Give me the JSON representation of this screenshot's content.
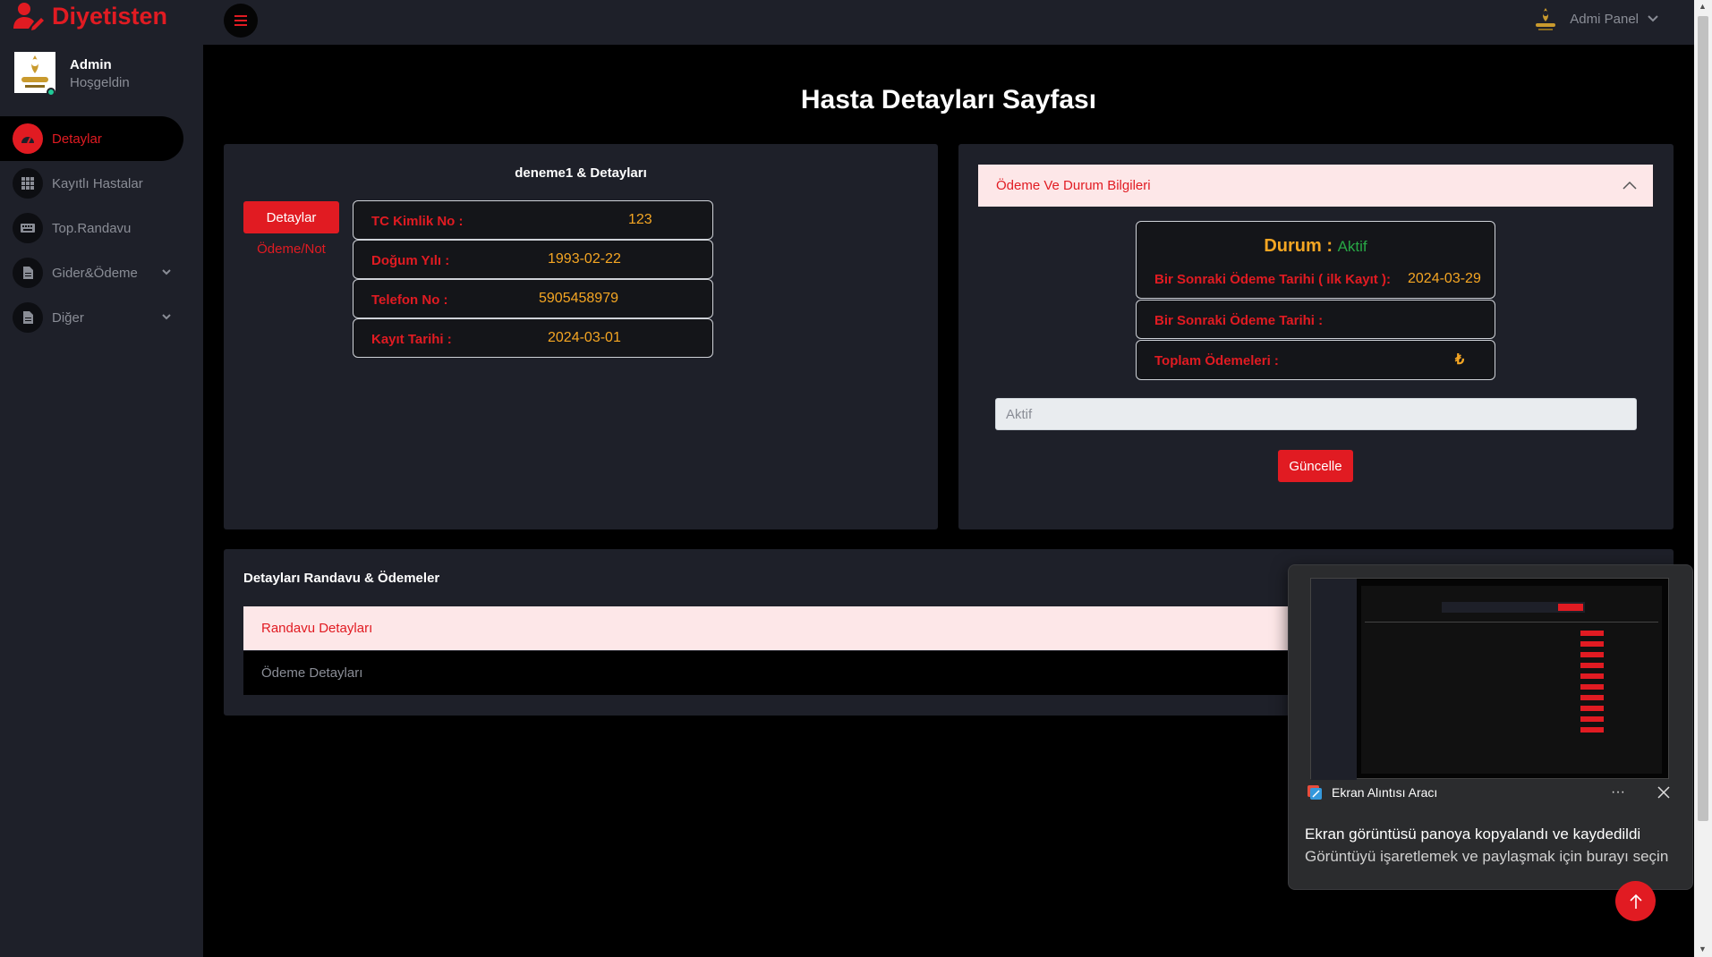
{
  "brand": {
    "name": "Diyetisten"
  },
  "header": {
    "admin_label": "Admi Panel"
  },
  "profile": {
    "name": "Admin",
    "subtitle": "Hoşgeldin"
  },
  "sidebar": {
    "items": [
      {
        "label": "Detaylar",
        "icon": "dashboard-icon"
      },
      {
        "label": "Kayıtlı Hastalar",
        "icon": "grid-icon"
      },
      {
        "label": "Top.Randavu",
        "icon": "keyboard-icon"
      },
      {
        "label": "Gider&Ödeme",
        "icon": "document-icon"
      },
      {
        "label": "Diğer",
        "icon": "document-icon"
      }
    ]
  },
  "page": {
    "title": "Hasta Detayları Sayfası"
  },
  "patient": {
    "title": "deneme1 & Detayları",
    "tabs": {
      "details": "Detaylar",
      "payment": "Ödeme/Not"
    },
    "fields": [
      {
        "label": "TC Kimlik No :",
        "value": "123"
      },
      {
        "label": "Doğum Yılı :",
        "value": "1993-02-22"
      },
      {
        "label": "Telefon No :",
        "value": "5905458979"
      },
      {
        "label": "Kayıt Tarihi :",
        "value": "2024-03-01"
      }
    ]
  },
  "status": {
    "accordion_title": "Ödeme Ve Durum Bilgileri",
    "durum_label": "Durum :",
    "durum_value": "Aktif",
    "next_payment_first_label": "Bir Sonraki Ödeme Tarihi ( ilk Kayıt ):",
    "next_payment_first_value": "2024-03-29",
    "next_payment_label": "Bir Sonraki Ödeme Tarihi :",
    "next_payment_value": "",
    "total_label": "Toplam Ödemeleri :",
    "total_value": "₺",
    "select_value": "Aktif",
    "update_button": "Güncelle"
  },
  "appointments": {
    "title": "Detayları Randavu & Ödemeler",
    "sections": [
      "Randavu Detayları",
      "Ödeme Detayları"
    ]
  },
  "toast": {
    "app_name": "Ekran Alıntısı Aracı",
    "more": "···",
    "title": "Ekran görüntüsü panoya kopyalandı ve kaydedildi",
    "message": "Görüntüyü işaretlemek ve paylaşmak için burayı seçin"
  },
  "colors": {
    "accent": "#e11b22",
    "panel": "#1e2029",
    "value": "#f5a623",
    "success": "#28a745"
  }
}
